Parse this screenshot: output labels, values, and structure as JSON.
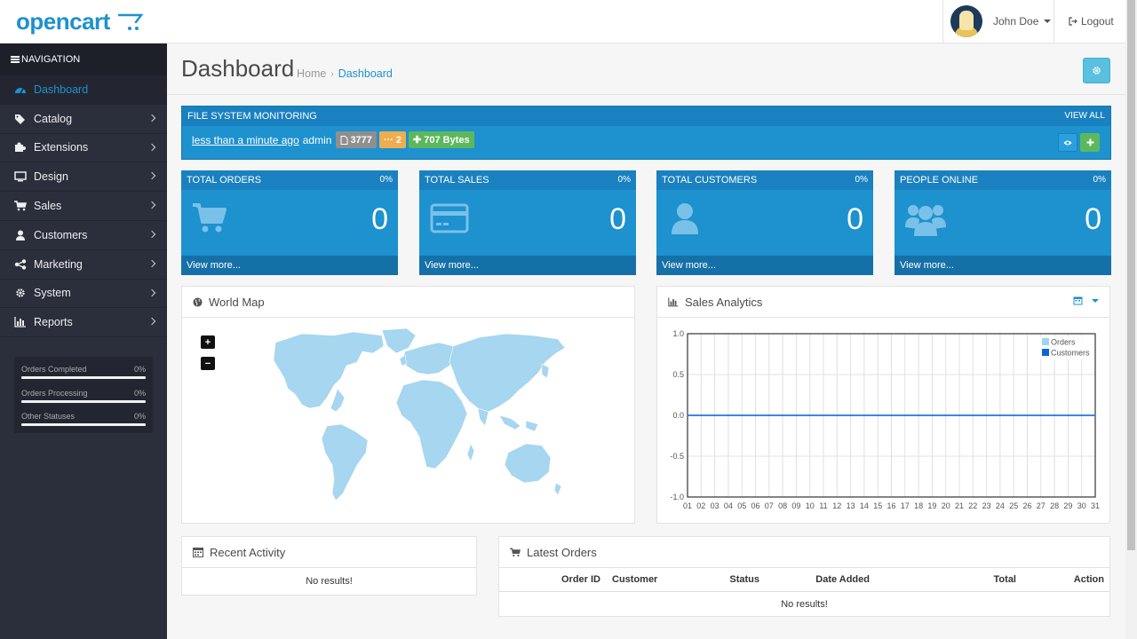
{
  "brand": {
    "name": "opencart"
  },
  "header": {
    "user_name": "John Doe",
    "logout_label": "Logout"
  },
  "sidebar": {
    "title": "NAVIGATION",
    "items": [
      {
        "label": "Dashboard",
        "icon": "dashboard-icon"
      },
      {
        "label": "Catalog",
        "icon": "tags-icon"
      },
      {
        "label": "Extensions",
        "icon": "puzzle-icon"
      },
      {
        "label": "Design",
        "icon": "desktop-icon"
      },
      {
        "label": "Sales",
        "icon": "cart-icon"
      },
      {
        "label": "Customers",
        "icon": "user-icon"
      },
      {
        "label": "Marketing",
        "icon": "share-icon"
      },
      {
        "label": "System",
        "icon": "gear-icon"
      },
      {
        "label": "Reports",
        "icon": "bar-chart-icon"
      }
    ],
    "progress": [
      {
        "label": "Orders Completed",
        "pct": "0%"
      },
      {
        "label": "Orders Processing",
        "pct": "0%"
      },
      {
        "label": "Other Statuses",
        "pct": "0%"
      }
    ]
  },
  "page": {
    "title": "Dashboard",
    "breadcrumb": [
      "Home",
      "Dashboard"
    ]
  },
  "fsm": {
    "title": "FILE SYSTEM MONITORING",
    "view_all": "VIEW ALL",
    "time": "less than a minute ago",
    "user": "admin",
    "files": "3777",
    "changed": "2",
    "added": "707 Bytes"
  },
  "tiles": [
    {
      "title": "TOTAL ORDERS",
      "pct": "0%",
      "value": "0",
      "more": "View more..."
    },
    {
      "title": "TOTAL SALES",
      "pct": "0%",
      "value": "0",
      "more": "View more..."
    },
    {
      "title": "TOTAL CUSTOMERS",
      "pct": "0%",
      "value": "0",
      "more": "View more..."
    },
    {
      "title": "PEOPLE ONLINE",
      "pct": "0%",
      "value": "0",
      "more": "View more..."
    }
  ],
  "world_map": {
    "title": "World Map",
    "zoom_in": "+",
    "zoom_out": "−"
  },
  "analytics": {
    "title": "Sales Analytics",
    "legend": [
      "Orders",
      "Customers"
    ]
  },
  "chart_data": {
    "type": "line",
    "x": [
      "01",
      "02",
      "03",
      "04",
      "05",
      "06",
      "07",
      "08",
      "09",
      "10",
      "11",
      "12",
      "13",
      "14",
      "15",
      "16",
      "17",
      "18",
      "19",
      "20",
      "21",
      "22",
      "23",
      "24",
      "25",
      "26",
      "27",
      "28",
      "29",
      "30",
      "31"
    ],
    "series": [
      {
        "name": "Orders",
        "values": [
          0,
          0,
          0,
          0,
          0,
          0,
          0,
          0,
          0,
          0,
          0,
          0,
          0,
          0,
          0,
          0,
          0,
          0,
          0,
          0,
          0,
          0,
          0,
          0,
          0,
          0,
          0,
          0,
          0,
          0,
          0
        ],
        "color": "#9fd5f0"
      },
      {
        "name": "Customers",
        "values": [
          0,
          0,
          0,
          0,
          0,
          0,
          0,
          0,
          0,
          0,
          0,
          0,
          0,
          0,
          0,
          0,
          0,
          0,
          0,
          0,
          0,
          0,
          0,
          0,
          0,
          0,
          0,
          0,
          0,
          0,
          0
        ],
        "color": "#1065d6"
      }
    ],
    "yticks": [
      "1.0",
      "0.5",
      "0.0",
      "-0.5",
      "-1.0"
    ],
    "ylim": [
      -1.0,
      1.0
    ],
    "grid": true,
    "legend_position": "top-right"
  },
  "recent_activity": {
    "title": "Recent Activity",
    "empty": "No results!"
  },
  "latest_orders": {
    "title": "Latest Orders",
    "columns": [
      "Order ID",
      "Customer",
      "Status",
      "Date Added",
      "Total",
      "Action"
    ],
    "empty": "No results!"
  },
  "colors": {
    "primary": "#1e91cf",
    "sidebar": "#2b2f3c",
    "success": "#5cb85c",
    "warning": "#f0ad4e",
    "info": "#5bc0de"
  }
}
